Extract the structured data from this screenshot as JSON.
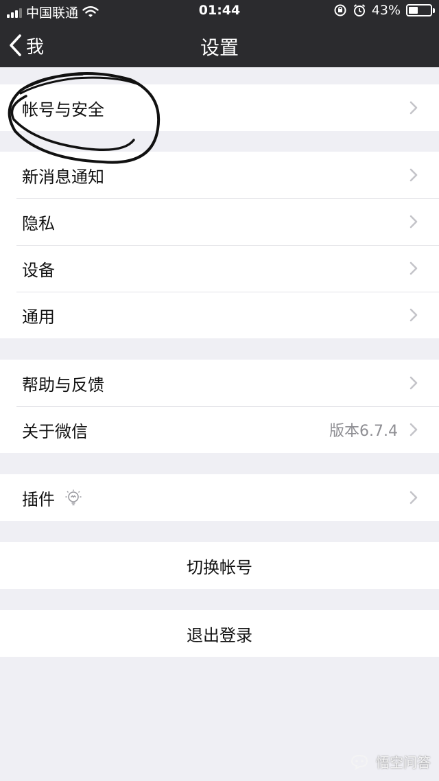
{
  "status_bar": {
    "carrier": "中国联通",
    "time": "01:44",
    "battery": "43%",
    "battery_level": 0.43
  },
  "nav": {
    "back_label": "我",
    "title": "设置"
  },
  "groups": {
    "account": {
      "label": "帐号与安全"
    },
    "notifications": {
      "label": "新消息通知"
    },
    "privacy": {
      "label": "隐私"
    },
    "devices": {
      "label": "设备"
    },
    "general": {
      "label": "通用"
    },
    "help": {
      "label": "帮助与反馈"
    },
    "about": {
      "label": "关于微信",
      "value": "版本6.7.4"
    },
    "plugins": {
      "label": "插件"
    },
    "switch_account": {
      "label": "切换帐号"
    },
    "logout": {
      "label": "退出登录"
    }
  },
  "watermark": {
    "text": "悟空问答"
  },
  "colors": {
    "nav_bg": "#2b2b2e",
    "page_bg": "#efeff4",
    "separator": "#e2e2e6",
    "secondary_text": "#8e8e93"
  },
  "icons": [
    "back-chevron-icon",
    "chevron-right-icon",
    "wifi-icon",
    "battery-icon",
    "alarm-icon",
    "rotation-lock-icon",
    "lightbulb-icon"
  ]
}
